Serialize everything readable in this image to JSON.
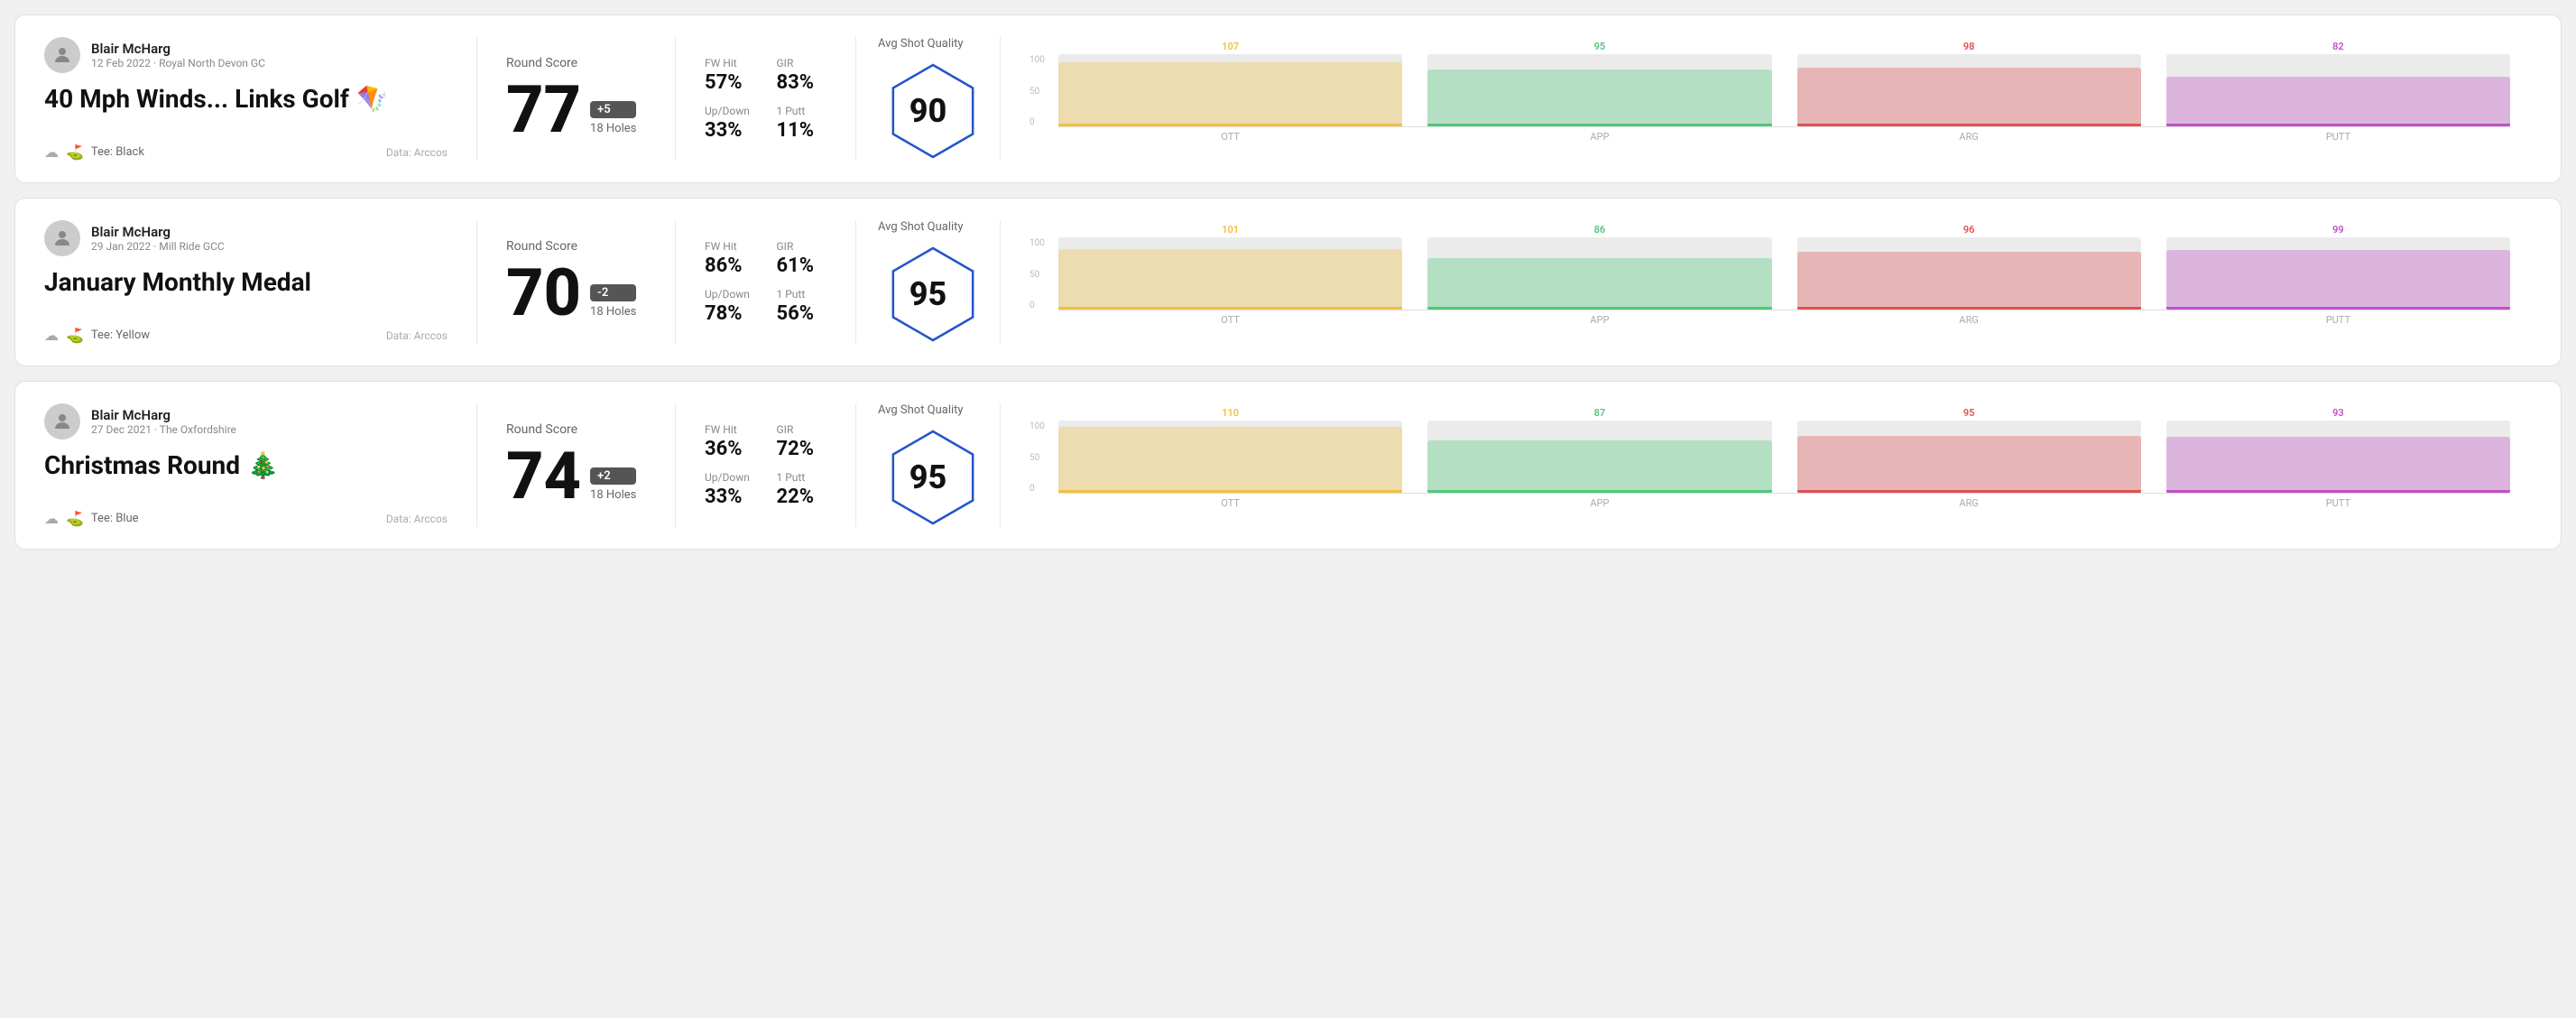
{
  "rounds": [
    {
      "id": "round-1",
      "user": {
        "name": "Blair McHarg",
        "meta": "12 Feb 2022 · Royal North Devon GC"
      },
      "title": "40 Mph Winds... Links Golf",
      "titleEmoji": "🪁",
      "tee": "Black",
      "dataSource": "Data: Arccos",
      "score": "77",
      "scoreDiff": "+5",
      "holes": "18 Holes",
      "fwHit": "57%",
      "gir": "83%",
      "upDown": "33%",
      "onePutt": "11%",
      "avgShotQuality": 90,
      "chart": {
        "bars": [
          {
            "label": "OTT",
            "value": 107,
            "color": "#f0c040"
          },
          {
            "label": "APP",
            "value": 95,
            "color": "#50c878"
          },
          {
            "label": "ARG",
            "value": 98,
            "color": "#e05050"
          },
          {
            "label": "PUTT",
            "value": 82,
            "color": "#c050c8"
          }
        ]
      }
    },
    {
      "id": "round-2",
      "user": {
        "name": "Blair McHarg",
        "meta": "29 Jan 2022 · Mill Ride GCC"
      },
      "title": "January Monthly Medal",
      "titleEmoji": "",
      "tee": "Yellow",
      "dataSource": "Data: Arccos",
      "score": "70",
      "scoreDiff": "-2",
      "holes": "18 Holes",
      "fwHit": "86%",
      "gir": "61%",
      "upDown": "78%",
      "onePutt": "56%",
      "avgShotQuality": 95,
      "chart": {
        "bars": [
          {
            "label": "OTT",
            "value": 101,
            "color": "#f0c040"
          },
          {
            "label": "APP",
            "value": 86,
            "color": "#50c878"
          },
          {
            "label": "ARG",
            "value": 96,
            "color": "#e05050"
          },
          {
            "label": "PUTT",
            "value": 99,
            "color": "#c050c8"
          }
        ]
      }
    },
    {
      "id": "round-3",
      "user": {
        "name": "Blair McHarg",
        "meta": "27 Dec 2021 · The Oxfordshire"
      },
      "title": "Christmas Round",
      "titleEmoji": "🎄",
      "tee": "Blue",
      "dataSource": "Data: Arccos",
      "score": "74",
      "scoreDiff": "+2",
      "holes": "18 Holes",
      "fwHit": "36%",
      "gir": "72%",
      "upDown": "33%",
      "onePutt": "22%",
      "avgShotQuality": 95,
      "chart": {
        "bars": [
          {
            "label": "OTT",
            "value": 110,
            "color": "#f0c040"
          },
          {
            "label": "APP",
            "value": 87,
            "color": "#50c878"
          },
          {
            "label": "ARG",
            "value": 95,
            "color": "#e05050"
          },
          {
            "label": "PUTT",
            "value": 93,
            "color": "#c050c8"
          }
        ]
      }
    }
  ],
  "labels": {
    "roundScore": "Round Score",
    "fwHit": "FW Hit",
    "gir": "GIR",
    "upDown": "Up/Down",
    "onePutt": "1 Putt",
    "avgShotQuality": "Avg Shot Quality",
    "teePrefix": "Tee:",
    "dataArccos": "Data: Arccos"
  }
}
